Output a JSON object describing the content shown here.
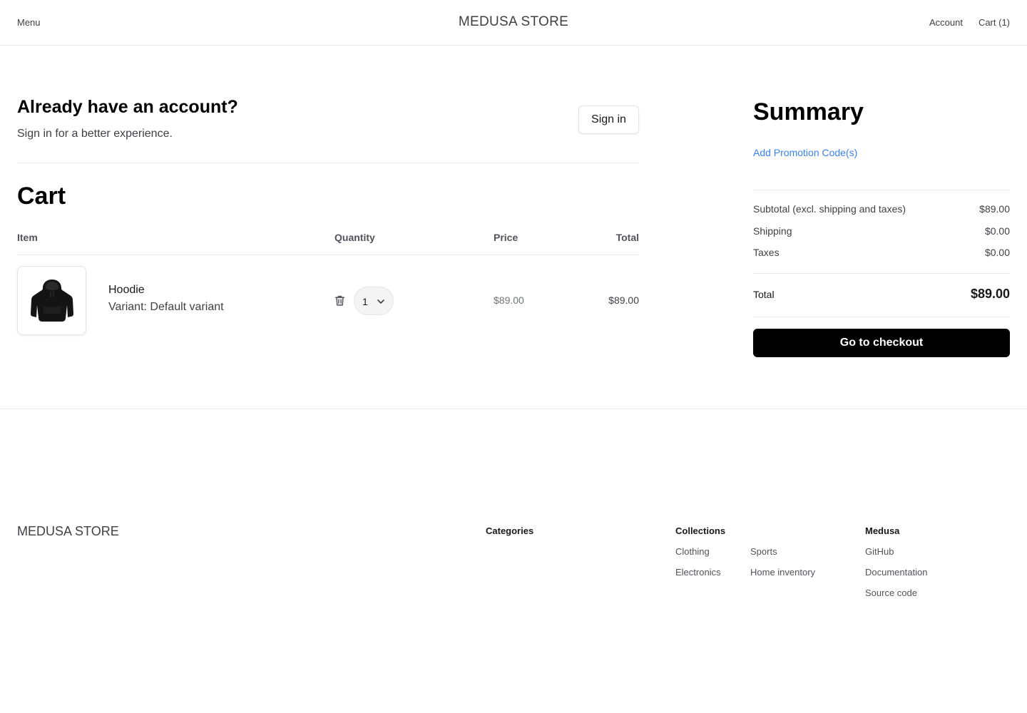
{
  "nav": {
    "menu_label": "Menu",
    "brand": "MEDUSA STORE",
    "account_label": "Account",
    "cart_label": "Cart (1)"
  },
  "signin": {
    "title": "Already have an account?",
    "subtitle": "Sign in for a better experience.",
    "button_label": "Sign in"
  },
  "cart": {
    "title": "Cart",
    "columns": [
      "Item",
      "Quantity",
      "Price",
      "Total"
    ],
    "items": [
      {
        "name": "Hoodie",
        "variant": "Variant: Default variant",
        "quantity": "1",
        "price": "$89.00",
        "total": "$89.00",
        "thumbnail_icon": "hoodie-image"
      }
    ]
  },
  "summary": {
    "title": "Summary",
    "promo_link": "Add Promotion Code(s)",
    "rows": [
      {
        "label": "Subtotal (excl. shipping and taxes)",
        "value": "$89.00"
      },
      {
        "label": "Shipping",
        "value": "$0.00"
      },
      {
        "label": "Taxes",
        "value": "$0.00"
      }
    ],
    "total_label": "Total",
    "total_value": "$89.00",
    "checkout_label": "Go to checkout"
  },
  "footer": {
    "brand": "MEDUSA STORE",
    "categories_title": "Categories",
    "collections_title": "Collections",
    "collections": [
      "Clothing",
      "Sports",
      "Electronics",
      "Home inventory"
    ],
    "medusa_title": "Medusa",
    "medusa_links": [
      "GitHub",
      "Documentation",
      "Source code"
    ]
  },
  "colors": {
    "accent_link": "#3b82f6",
    "checkout_button": "#000000",
    "divider": "#e5e7eb"
  }
}
